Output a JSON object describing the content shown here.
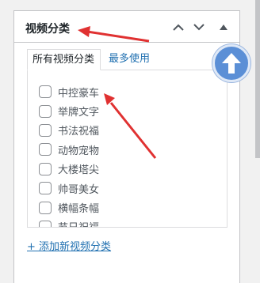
{
  "panel": {
    "title": "视频分类",
    "buttons": {
      "move_up": "chevron-up-icon",
      "move_down": "chevron-down-icon",
      "toggle": "triangle-up-icon"
    }
  },
  "tabs": [
    {
      "label": "所有视频分类",
      "active": true
    },
    {
      "label": "最多使用",
      "active": false
    }
  ],
  "categories": [
    {
      "label": "中控豪车",
      "checked": false
    },
    {
      "label": "举牌文字",
      "checked": false
    },
    {
      "label": "书法祝福",
      "checked": false
    },
    {
      "label": "动物宠物",
      "checked": false
    },
    {
      "label": "大楼塔尖",
      "checked": false
    },
    {
      "label": "帅哥美女",
      "checked": false
    },
    {
      "label": "横幅条幅",
      "checked": false
    },
    {
      "label": "节日祝福",
      "checked": false
    }
  ],
  "add_link": "+ 添加新视频分类",
  "colors": {
    "link": "#2271b1",
    "annotation_arrow": "#e03131",
    "fab": "#5b8fd6"
  }
}
